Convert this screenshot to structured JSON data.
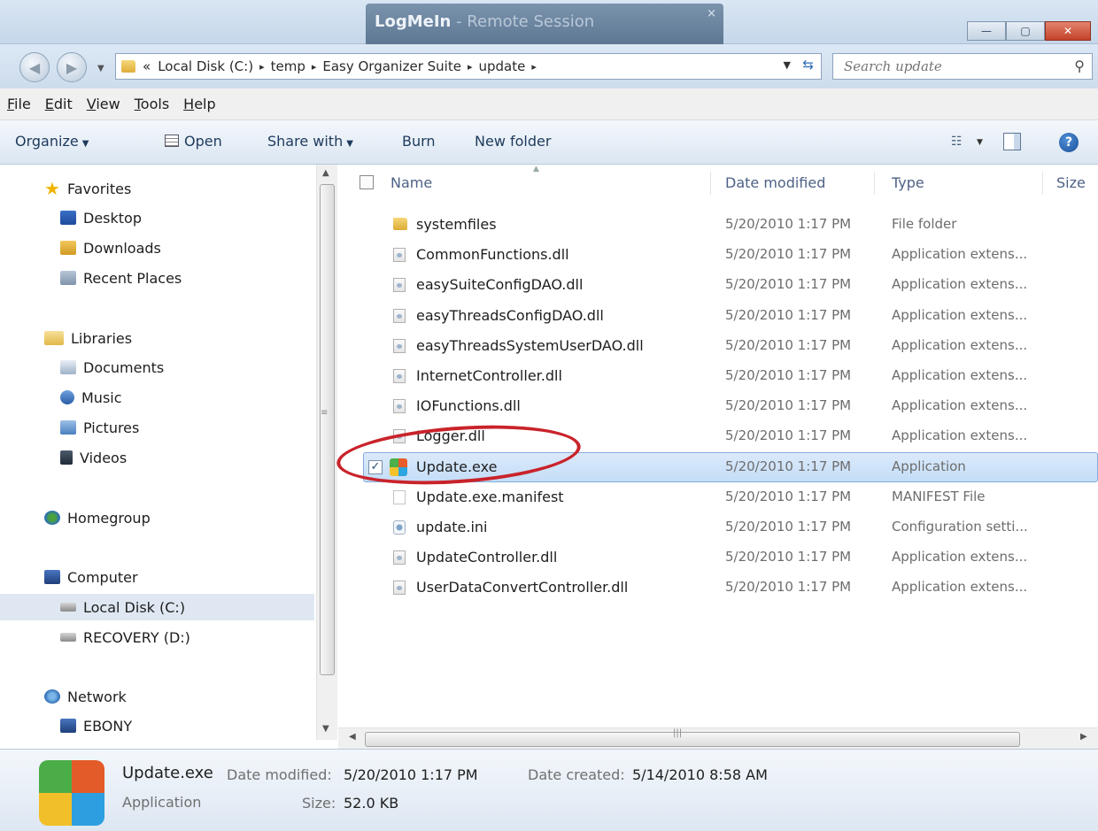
{
  "window": {
    "overlay_title": "LogMeIn",
    "overlay_subtitle": " - Remote Session",
    "overlay_close": "×",
    "min": "—",
    "max": "▢",
    "close": "✕"
  },
  "address": {
    "overflow": "«",
    "crumbs": [
      "Local Disk (C:)",
      "temp",
      "Easy Organizer Suite",
      "update"
    ],
    "sep": "▸",
    "search_placeholder": "Search update"
  },
  "menu": [
    "File",
    "Edit",
    "View",
    "Tools",
    "Help"
  ],
  "menu_accel": [
    "F",
    "E",
    "V",
    "T",
    "H"
  ],
  "commands": {
    "organize": "Organize",
    "open": "Open",
    "share": "Share with",
    "burn": "Burn",
    "new_folder": "New folder"
  },
  "nav": [
    {
      "label": "Favorites",
      "icon": "star-icon"
    },
    {
      "label": "Desktop",
      "icon": "desktop-icon"
    },
    {
      "label": "Downloads",
      "icon": "downloads-icon"
    },
    {
      "label": "Recent Places",
      "icon": "recent-places-icon"
    },
    {
      "label": "Libraries",
      "icon": "libraries-icon"
    },
    {
      "label": "Documents",
      "icon": "documents-icon"
    },
    {
      "label": "Music",
      "icon": "music-icon"
    },
    {
      "label": "Pictures",
      "icon": "pictures-icon"
    },
    {
      "label": "Videos",
      "icon": "videos-icon"
    },
    {
      "label": "Homegroup",
      "icon": "homegroup-icon"
    },
    {
      "label": "Computer",
      "icon": "computer-icon"
    },
    {
      "label": "Local Disk (C:)",
      "icon": "local-disk-icon"
    },
    {
      "label": "RECOVERY (D:)",
      "icon": "recovery-disk-icon"
    },
    {
      "label": "Network",
      "icon": "network-icon"
    },
    {
      "label": "EBONY",
      "icon": "network-pc-icon"
    }
  ],
  "columns": {
    "name": "Name",
    "date": "Date modified",
    "type": "Type",
    "size": "Size"
  },
  "files": [
    {
      "name": "systemfiles",
      "date": "5/20/2010 1:17 PM",
      "type": "File folder",
      "icon": "folder-icon"
    },
    {
      "name": "CommonFunctions.dll",
      "date": "5/20/2010 1:17 PM",
      "type": "Application extens...",
      "icon": "dll-icon"
    },
    {
      "name": "easySuiteConfigDAO.dll",
      "date": "5/20/2010 1:17 PM",
      "type": "Application extens...",
      "icon": "dll-icon"
    },
    {
      "name": "easyThreadsConfigDAO.dll",
      "date": "5/20/2010 1:17 PM",
      "type": "Application extens...",
      "icon": "dll-icon"
    },
    {
      "name": "easyThreadsSystemUserDAO.dll",
      "date": "5/20/2010 1:17 PM",
      "type": "Application extens...",
      "icon": "dll-icon"
    },
    {
      "name": "InternetController.dll",
      "date": "5/20/2010 1:17 PM",
      "type": "Application extens...",
      "icon": "dll-icon"
    },
    {
      "name": "IOFunctions.dll",
      "date": "5/20/2010 1:17 PM",
      "type": "Application extens...",
      "icon": "dll-icon"
    },
    {
      "name": "Logger.dll",
      "date": "5/20/2010 1:17 PM",
      "type": "Application extens...",
      "icon": "dll-icon"
    },
    {
      "name": "Update.exe",
      "date": "5/20/2010 1:17 PM",
      "type": "Application",
      "icon": "exe-icon",
      "selected": true
    },
    {
      "name": "Update.exe.manifest",
      "date": "5/20/2010 1:17 PM",
      "type": "MANIFEST File",
      "icon": "manifest-icon"
    },
    {
      "name": "update.ini",
      "date": "5/20/2010 1:17 PM",
      "type": "Configuration setti...",
      "icon": "ini-icon"
    },
    {
      "name": "UpdateController.dll",
      "date": "5/20/2010 1:17 PM",
      "type": "Application extens...",
      "icon": "dll-icon"
    },
    {
      "name": "UserDataConvertController.dll",
      "date": "5/20/2010 1:17 PM",
      "type": "Application extens...",
      "icon": "dll-icon"
    }
  ],
  "details": {
    "name": "Update.exe",
    "type": "Application",
    "date_modified_label": "Date modified:",
    "date_modified": "5/20/2010 1:17 PM",
    "date_created_label": "Date created:",
    "date_created": "5/14/2010 8:58 AM",
    "size_label": "Size:",
    "size": "52.0 KB"
  },
  "colors": {
    "annotation": "#c9232a",
    "selection": "#cde3f9"
  }
}
